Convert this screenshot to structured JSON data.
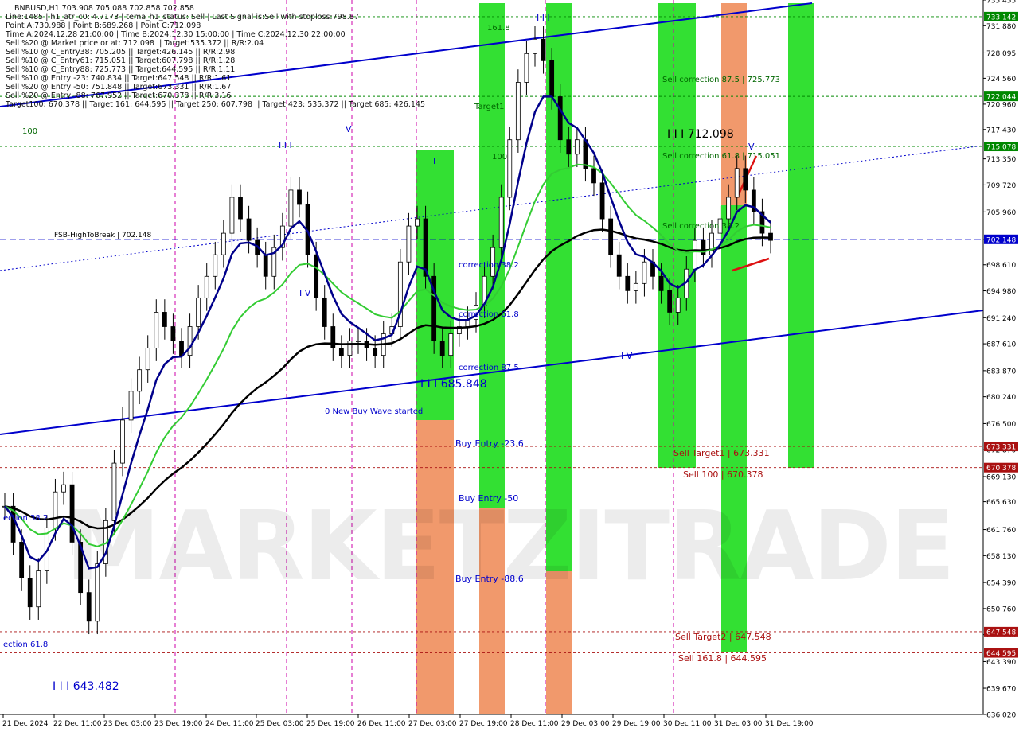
{
  "info": {
    "lines": [
      "BNBUSD,H1   703.908 705.088 702.858 702.858",
      "Line:1485 | h1_atr_c0: 4.7173 | tema_h1_status: Sell | Last Signal is:Sell with stoploss:798.87",
      "Point A:730.988 | Point B:689.268 | Point C:712.098",
      "Time A:2024.12.28 21:00:00 | Time B:2024.12.30 15:00:00 | Time C:2024.12.30 22:00:00",
      "Sell %20 @ Market price or at: 712.098 || Target:535.372 || R/R:2.04",
      "Sell %10 @ C_Entry38: 705.205 || Target:426.145 || R/R:2.98",
      "Sell %10 @ C_Entry61: 715.051 || Target:607.798 || R/R:1.28",
      "Sell %10 @ C_Entry88: 725.773 || Target:644.595 || R/R:1.11",
      "Sell %10 @ Entry -23: 740.834 || Target:647.548 || R/R:1.61",
      "Sell %20 @ Entry -50: 751.848 || Target:673.331 || R/R:1.67",
      "Sell %20 @ Entry -88: 767.952 || Target:670.378 || R/R:3.16",
      "Target100: 670.378 || Target 161: 644.595 || Target 250: 607.798 || Target 423: 535.372 || Target 685: 426.145"
    ]
  },
  "colors": {
    "green_band": "#22dd22",
    "orange_band": "#f09060",
    "blue": "#0000cc",
    "navy": "#00008b",
    "black_ma": "#000000",
    "green_ma": "#33cc33",
    "red": "#dd1111",
    "magenta": "#cc00aa",
    "green_level": "#008800",
    "brown_level": "#aa1111"
  },
  "chart_data": {
    "type": "candlestick",
    "symbol": "BNBUSD",
    "timeframe": "H1",
    "ylim": [
      636.02,
      735.455
    ],
    "y_ticks": [
      "735.455",
      "731.880",
      "728.095",
      "724.560",
      "720.960",
      "717.430",
      "713.350",
      "709.720",
      "705.960",
      "702.148",
      "698.610",
      "694.980",
      "691.240",
      "687.610",
      "683.870",
      "680.240",
      "676.500",
      "672.870",
      "669.130",
      "665.630",
      "661.760",
      "658.130",
      "654.390",
      "650.760",
      "647.130",
      "643.390",
      "639.670",
      "636.020"
    ],
    "x_labels": [
      "21 Dec 2024",
      "22 Dec 11:00",
      "23 Dec 03:00",
      "23 Dec 19:00",
      "24 Dec 11:00",
      "25 Dec 03:00",
      "25 Dec 19:00",
      "26 Dec 11:00",
      "27 Dec 03:00",
      "27 Dec 19:00",
      "28 Dec 11:00",
      "29 Dec 03:00",
      "29 Dec 19:00",
      "30 Dec 11:00",
      "31 Dec 03:00",
      "31 Dec 19:00"
    ],
    "close_series": [
      665,
      660,
      655,
      651,
      656,
      662,
      667,
      668,
      660,
      653,
      649,
      657,
      663,
      671,
      677,
      681,
      684,
      687,
      692,
      690,
      688,
      686,
      690,
      694,
      697,
      700,
      703,
      708,
      705,
      702,
      700,
      697,
      701,
      704,
      709,
      707,
      700,
      694,
      690,
      687,
      686,
      688,
      688,
      687,
      686,
      689,
      690,
      699,
      704,
      705,
      697,
      688,
      686,
      689,
      690,
      691,
      693,
      697,
      701,
      708,
      716,
      724,
      728,
      730,
      727,
      722,
      716,
      714,
      716,
      712,
      710,
      705,
      700,
      697,
      695,
      696,
      699,
      697,
      695,
      692,
      694,
      698,
      702,
      700,
      703,
      705,
      708,
      712,
      709,
      706,
      703,
      702
    ],
    "level_lines": [
      {
        "label": "733.142",
        "value": 733.142,
        "color": "#008800",
        "style": "dashed"
      },
      {
        "label": "722.044",
        "value": 722.044,
        "color": "#008800",
        "style": "dashed"
      },
      {
        "label": "715.078",
        "value": 715.078,
        "color": "#008800",
        "style": "dashed"
      },
      {
        "label": "702.148",
        "value": 702.148,
        "color": "#0000cc",
        "style": "dashed",
        "name": "FSB-HighToBreak | 702.148"
      },
      {
        "label": "673.331",
        "value": 673.331,
        "color": "#aa1111",
        "style": "dashed",
        "name": "Sell Target1 | 673.331"
      },
      {
        "label": "670.378",
        "value": 670.378,
        "color": "#aa1111",
        "style": "dashed",
        "name": "Sell 100 | 670.378"
      },
      {
        "label": "647.548",
        "value": 647.548,
        "color": "#aa1111",
        "style": "dashed",
        "name": "Sell Target2 | 647.548"
      },
      {
        "label": "644.595",
        "value": 644.595,
        "color": "#aa1111",
        "style": "dashed",
        "name": "Sell 161.8 | 644.595"
      }
    ],
    "current_price": "702.858",
    "annotations": [
      {
        "text": "161.8",
        "color": "#006600"
      },
      {
        "text": "Target1",
        "color": "#006600"
      },
      {
        "text": "100",
        "color": "#006600"
      },
      {
        "text": "100",
        "color": "#006600"
      },
      {
        "text": "I I I",
        "color": "#0000cc"
      },
      {
        "text": "I I I",
        "color": "#0000cc"
      },
      {
        "text": "V",
        "color": "#0000cc"
      },
      {
        "text": "V",
        "color": "#0000cc"
      },
      {
        "text": "I",
        "color": "#0000cc"
      },
      {
        "text": "I V",
        "color": "#0000cc"
      },
      {
        "text": "I V",
        "color": "#0000cc"
      },
      {
        "text": "I I I  712.098",
        "color": "#000000"
      },
      {
        "text": "Sell correction 87.5 | 725.773",
        "color": "#006600"
      },
      {
        "text": "Sell correction 61.8 | 715.051",
        "color": "#006600"
      },
      {
        "text": "Sell correction 38.2",
        "color": "#006600"
      },
      {
        "text": "correction 38.2",
        "color": "#0000cc"
      },
      {
        "text": "correction 61.8",
        "color": "#0000cc"
      },
      {
        "text": "correction 87.5",
        "color": "#0000cc"
      },
      {
        "text": "I I I  685.848",
        "color": "#0000cc"
      },
      {
        "text": "0 New Buy Wave started",
        "color": "#0000cc"
      },
      {
        "text": "Buy Entry -23.6",
        "color": "#0000cc"
      },
      {
        "text": "Buy Entry -50",
        "color": "#0000cc"
      },
      {
        "text": "Buy Entry -88.6",
        "color": "#0000cc"
      },
      {
        "text": "I I I  643.482",
        "color": "#0000cc"
      },
      {
        "text": "ection 61.8",
        "color": "#0000cc"
      },
      {
        "text": "ection 38.2",
        "color": "#0000cc"
      }
    ],
    "watermark": "MARKETZITRADE"
  }
}
